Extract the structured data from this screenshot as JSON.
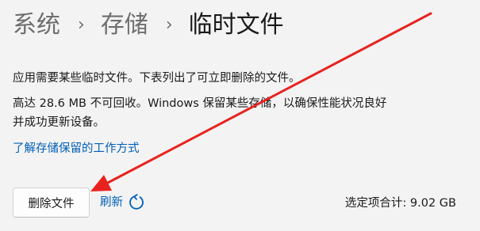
{
  "breadcrumb": {
    "items": [
      "系统",
      "存储"
    ],
    "separator": "›",
    "current": "临时文件"
  },
  "description": {
    "line1": "应用需要某些临时文件。下表列出了可立即删除的文件。",
    "line2a": "高达 28.6 MB 不可回收。Windows 保留某些存储，以确保性能状况良好",
    "line2b": "并成功更新设备。"
  },
  "learn_more_link": "了解存储保留的工作方式",
  "actions": {
    "delete_label": "删除文件",
    "refresh_label": "刷新",
    "refresh_icon": "refresh-icon"
  },
  "total_selected": "选定项合计: 9.02 GB",
  "colors": {
    "link": "#005fb8",
    "annotation_arrow": "#e8231f",
    "background": "#f3f3f3"
  }
}
